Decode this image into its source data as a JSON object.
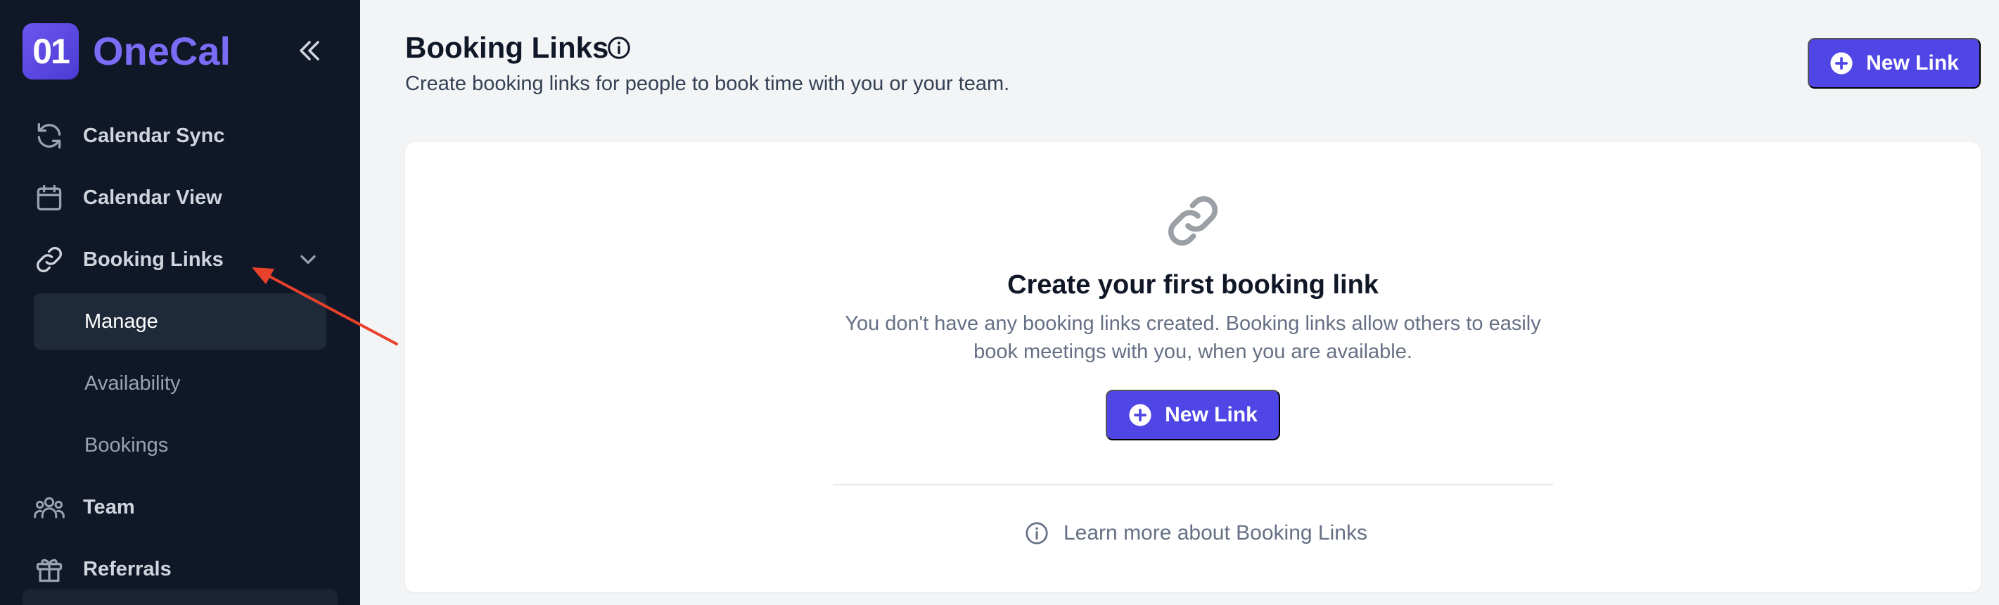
{
  "app": {
    "logo_mark": "01",
    "logo_text": "OneCal"
  },
  "sidebar": {
    "items": [
      {
        "label": "Calendar Sync",
        "icon": "refresh-icon"
      },
      {
        "label": "Calendar View",
        "icon": "calendar-icon"
      },
      {
        "label": "Booking Links",
        "icon": "link-icon",
        "expanded": true,
        "children": [
          {
            "label": "Manage",
            "active": true
          },
          {
            "label": "Availability",
            "active": false
          },
          {
            "label": "Bookings",
            "active": false
          }
        ]
      },
      {
        "label": "Team",
        "icon": "team-icon"
      },
      {
        "label": "Referrals",
        "icon": "gift-icon"
      }
    ]
  },
  "header": {
    "title": "Booking Links",
    "subtitle": "Create booking links for people to book time with you or your team.",
    "new_link_label": "New Link"
  },
  "empty_state": {
    "icon": "link-icon",
    "title": "Create your first booking link",
    "description": "You don't have any booking links created. Booking links allow others to easily book meetings with you, when you are available.",
    "button_label": "New Link",
    "learn_more": "Learn more about Booking Links"
  },
  "colors": {
    "sidebar_bg": "#101828",
    "accent": "#4f46e5",
    "annotation_arrow": "#e8412c"
  }
}
